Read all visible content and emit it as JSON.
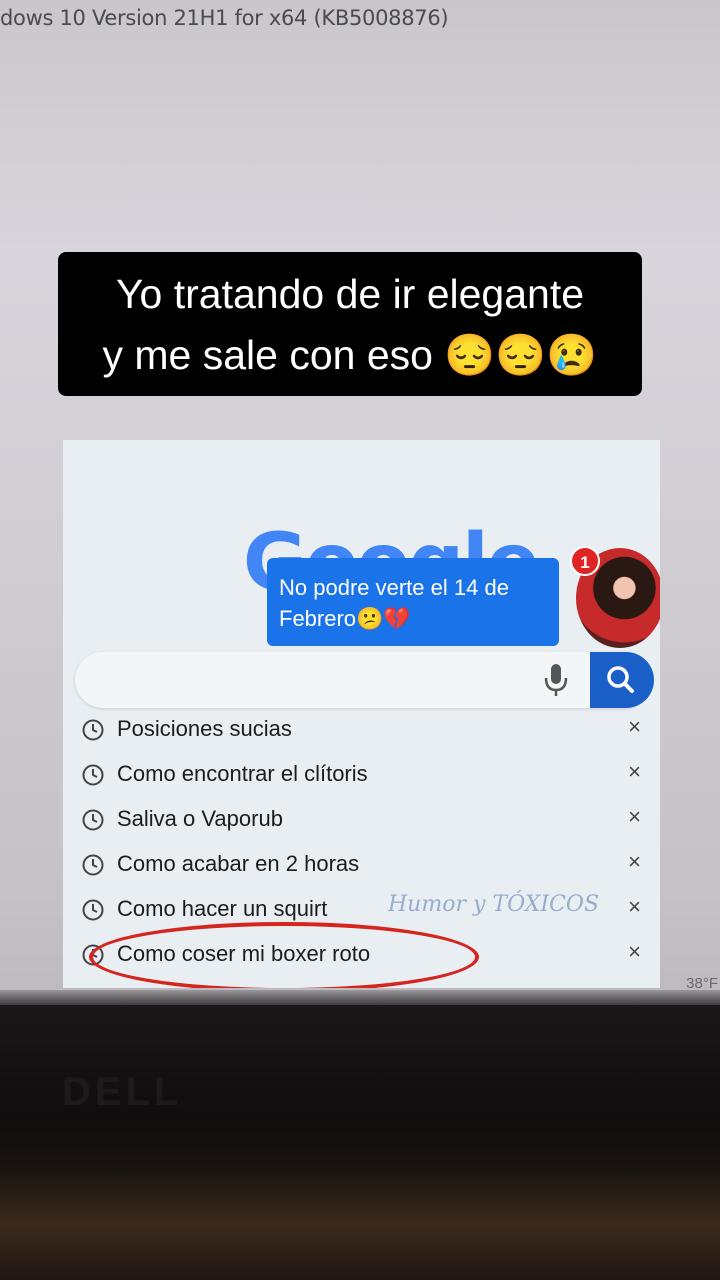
{
  "background": {
    "os_text": "dows 10 Version 21H1 for x64 (KB5008876)",
    "temperature": "38°F",
    "brand": "DELL"
  },
  "caption": {
    "line1": "Yo tratando de ir elegante",
    "line2": "y me sale con eso 😔😔😢"
  },
  "screenshot": {
    "logo": "Google",
    "notification": {
      "badge_count": "1",
      "message_line1": "No podre verte el 14 de",
      "message_line2": "Febrero😕💔"
    },
    "search": {
      "value": "",
      "mic_icon": "mic-icon",
      "search_icon": "search-icon"
    },
    "history": [
      {
        "text": "Posiciones sucias"
      },
      {
        "text": "Como encontrar el clítoris"
      },
      {
        "text": "Saliva o Vaporub"
      },
      {
        "text": "Como acabar en 2 horas"
      },
      {
        "text": "Como hacer un squirt"
      },
      {
        "text": "Como coser mi boxer roto"
      }
    ],
    "remove_symbol": "×",
    "watermark": "Humor y TÓXICOS"
  },
  "colors": {
    "google_blue": "#1a73e8",
    "highlight_red": "#d4251f"
  }
}
